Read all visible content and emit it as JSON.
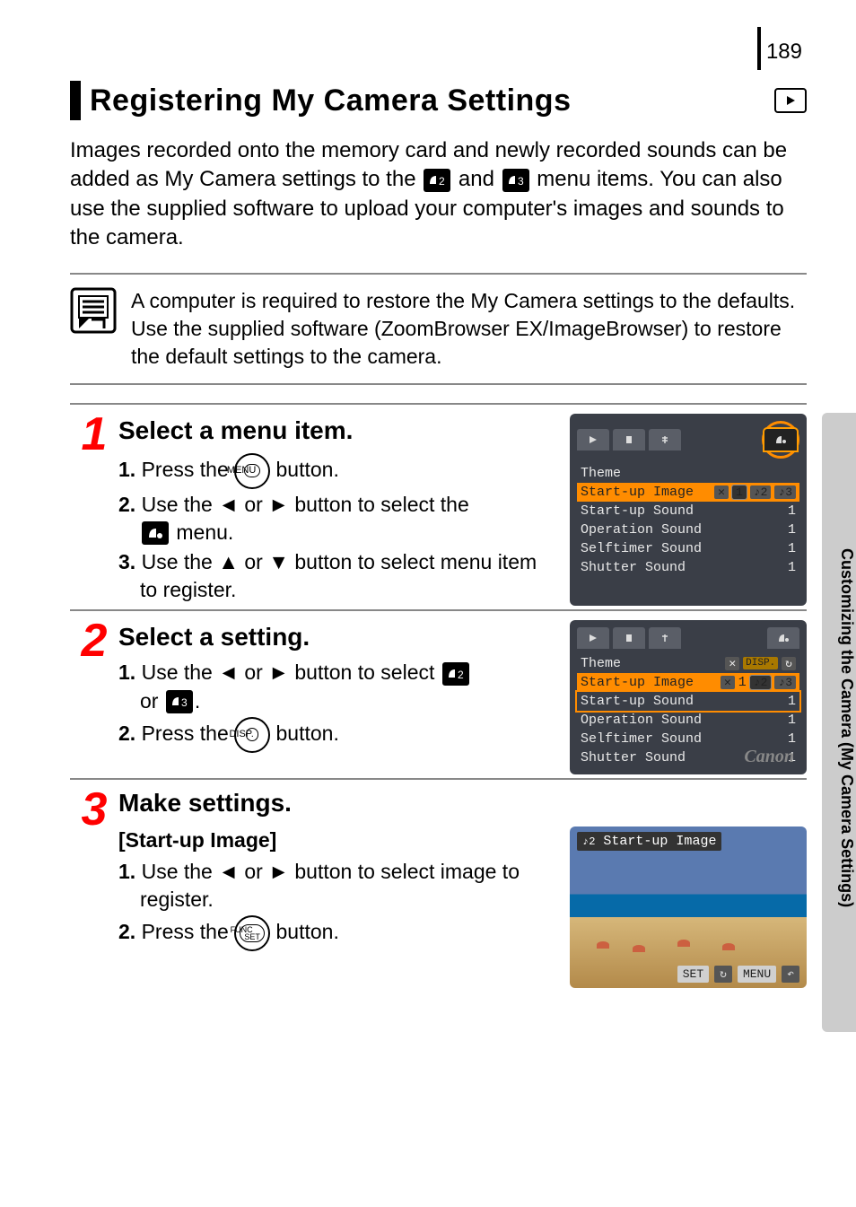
{
  "page_number": "189",
  "title": "Registering My Camera Settings",
  "intro_before_icons": "Images recorded onto the memory card and newly recorded sounds can be added as My Camera settings to the ",
  "intro_between_icons": " and ",
  "intro_after_icons": " menu items. You can also use the supplied software to upload your computer's images and sounds to the camera.",
  "note": "A computer is required to restore the My Camera settings to the defaults. Use the supplied software (ZoomBrowser EX/ImageBrowser) to restore the default settings to the camera.",
  "side_tab": "Customizing the Camera (My Camera Settings)",
  "steps": [
    {
      "num": "1",
      "heading": "Select a menu item.",
      "lines": {
        "l1_a": "1.",
        "l1_b": "Press the ",
        "l1_btn": "MENU",
        "l1_c": " button.",
        "l2_a": "2.",
        "l2_b": "Use the ",
        "l2_arr1": "◄",
        "l2_mid": " or ",
        "l2_arr2": "►",
        "l2_c": " button to select the ",
        "l2_d": " menu.",
        "l3_a": "3.",
        "l3_b": "Use the ",
        "l3_arr1": "▲",
        "l3_mid": " or ",
        "l3_arr2": "▼",
        "l3_c": " button to select menu item to register."
      }
    },
    {
      "num": "2",
      "heading": "Select a setting.",
      "lines": {
        "l1_a": "1.",
        "l1_b": "Use the ",
        "l1_arr1": "◄",
        "l1_mid": " or ",
        "l1_arr2": "►",
        "l1_c": " button to select ",
        "l1_d": "or ",
        "l1_e": ".",
        "l2_a": "2.",
        "l2_b": "Press the ",
        "l2_btn": "DISP.",
        "l2_c": " button."
      }
    },
    {
      "num": "3",
      "heading": "Make settings.",
      "sub_heading": "[Start-up Image]",
      "lines": {
        "l1_a": "1.",
        "l1_b": "Use the ",
        "l1_arr1": "◄",
        "l1_mid": " or ",
        "l1_arr2": "►",
        "l1_c": " button to select image to register.",
        "l2_a": "2.",
        "l2_b": "Press the ",
        "l2_btn": "FUNC SET",
        "l2_c": " button."
      }
    }
  ],
  "screenshot1": {
    "rows": [
      {
        "label": "Theme",
        "val": ""
      },
      {
        "label": "Start-up Image",
        "val": ""
      },
      {
        "label": "Start-up Sound",
        "val": "1"
      },
      {
        "label": "Operation Sound",
        "val": "1"
      },
      {
        "label": "Selftimer Sound",
        "val": "1"
      },
      {
        "label": "Shutter Sound",
        "val": "1"
      }
    ],
    "chips": [
      "1"
    ]
  },
  "screenshot2": {
    "rows": [
      {
        "label": "Theme",
        "val": ""
      },
      {
        "label": "Start-up Image",
        "val": ""
      },
      {
        "label": "Start-up Sound",
        "val": "1"
      },
      {
        "label": "Operation Sound",
        "val": "1"
      },
      {
        "label": "Selftimer Sound",
        "val": "1"
      },
      {
        "label": "Shutter Sound",
        "val": "1"
      }
    ],
    "disp": "DISP.",
    "chips": [
      "1"
    ],
    "brand": "Canon"
  },
  "screenshot3": {
    "title": "Start-up Image",
    "set": "SET",
    "menu": "MENU"
  }
}
